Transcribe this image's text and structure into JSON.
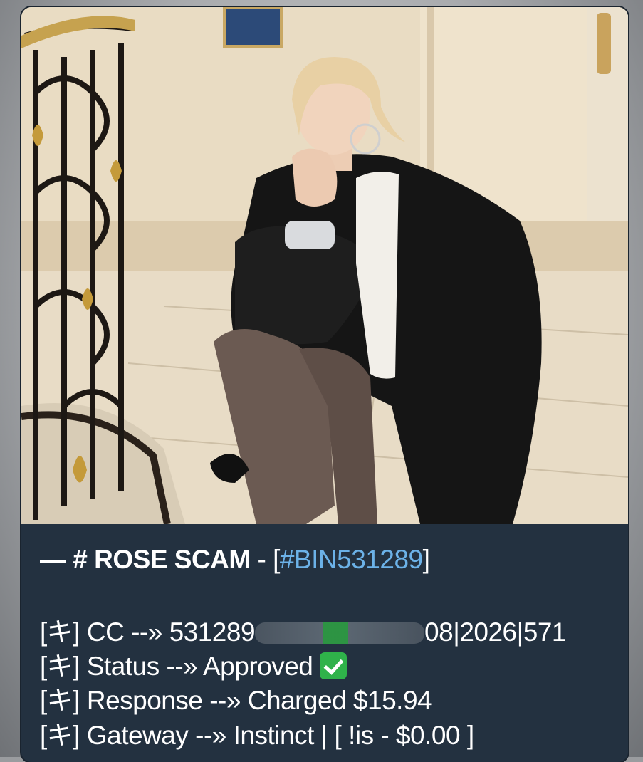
{
  "message": {
    "title": {
      "prefix": "— #",
      "name": "ROSE SCAM",
      "sep": "-",
      "open_bracket": "[",
      "tag": "#BIN531289",
      "close_bracket": "]"
    },
    "lines": [
      {
        "marker": "[キ]",
        "label": "CC --»",
        "value_start": "531289",
        "value_end": "08|2026|571"
      },
      {
        "marker": "[キ]",
        "label": "Status --»",
        "value": "Approved"
      },
      {
        "marker": "[キ]",
        "label": "Response --»",
        "value": "Charged $15.94"
      },
      {
        "marker": "[キ]",
        "label": "Gateway --»",
        "value": "Instinct | [ !is - $0.00 ]"
      }
    ],
    "status_icon": "check-mark-button-emoji",
    "accent_color": "#6cb2e8",
    "background_color": "#233140"
  },
  "photo": {
    "subject": "woman in black coat sitting on stairs beside ornate railing"
  }
}
